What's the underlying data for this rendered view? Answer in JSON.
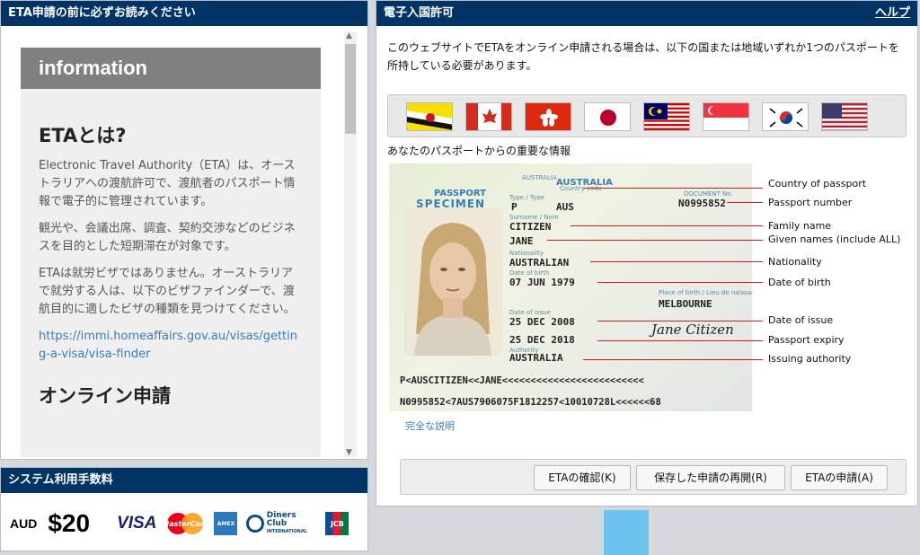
{
  "left_panel": {
    "header": "ETA申請の前に必ずお読みください",
    "info_title": "information",
    "section1_title": "ETAとは?",
    "para1": "Electronic Travel Authority（ETA）は、オーストラリアへの渡航許可で、渡航者のパスポート情報で電子的に管理されています。",
    "para2": "観光や、会議出席、調査、契約交渉などのビジネスを目的とした短期滞在が対象です。",
    "para3": "ETAは就労ビザではありません。オーストラリアで就労する人は、以下のビザファインダーで、渡航目的に適したビザの種類を見つけてください。",
    "link": "https://immi.homeaffairs.gov.au/visas/getting-a-visa/visa-finder",
    "section2_title": "オンライン申請"
  },
  "fee_panel": {
    "header": "システム利用手数料",
    "currency": "AUD",
    "amount": "$20",
    "cards": [
      "VISA",
      "MasterCard",
      "AMEX",
      "Diners Club",
      "JCB"
    ],
    "diners_sub": "INTERNATIONAL"
  },
  "right_panel": {
    "header": "電子入国許可",
    "help": "ヘルプ",
    "intro": "このウェブサイトでETAをオンライン申請される場合は、以下の国または地域いずれか1つのパスポートを所持している必要があります。",
    "flags": [
      "brunei",
      "canada",
      "hong-kong",
      "japan",
      "malaysia",
      "singapore",
      "south-korea",
      "united-states"
    ],
    "section_title": "あなたのパスポートからの重要な情報",
    "full_link": "完全な説明",
    "buttons": {
      "check": "ETAの確認(K)",
      "resume": "保存した申請の再開(R)",
      "apply": "ETAの申請(A)"
    }
  },
  "passport": {
    "header_word": "PASSPORT",
    "specimen": "SPECIMEN",
    "country": "AUSTRALIA",
    "type": "P",
    "code": "AUS",
    "number": "N0995852",
    "surname": "CITIZEN",
    "given": "JANE",
    "nationality": "AUSTRALIAN",
    "dob": "07 JUN 1979",
    "birthplace": "MELBOURNE",
    "issue": "25 DEC 2008",
    "expiry": "25 DEC 2018",
    "authority": "AUSTRALIA",
    "signature": "Jane Citizen",
    "mrz1": "P<AUSCITIZEN<<JANE<<<<<<<<<<<<<<<<<<<<<<<<<",
    "mrz2": "N0995852<7AUS7906075F1812257<10010728L<<<<<<68"
  },
  "labels": {
    "country": "Country of passport",
    "number": "Passport number",
    "family": "Family name",
    "given": "Given names (include ALL)",
    "nationality": "Nationality",
    "dob": "Date of birth",
    "issue": "Date of issue",
    "expiry": "Passport expiry",
    "authority": "Issuing authority"
  },
  "colors": {
    "header_bg": "#003366",
    "link": "#3a7ac0",
    "pointer_line": "#d61c1c"
  }
}
